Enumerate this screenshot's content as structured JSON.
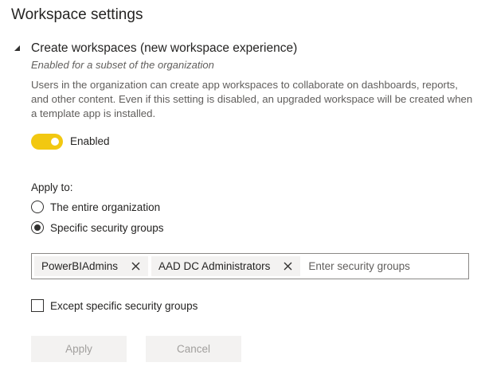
{
  "page": {
    "title": "Workspace settings"
  },
  "section": {
    "title": "Create workspaces (new workspace experience)",
    "subtitle": "Enabled for a subset of the organization",
    "description": "Users in the organization can create app workspaces to collaborate on dashboards, reports, and other content. Even if this setting is disabled, an upgraded workspace will be created when a template app is installed.",
    "collapse_icon": "triangle-down-icon"
  },
  "toggle": {
    "label": "Enabled",
    "on": true,
    "color": "#f2c811"
  },
  "apply_to": {
    "label": "Apply to:",
    "options": [
      {
        "label": "The entire organization",
        "checked": false
      },
      {
        "label": "Specific security groups",
        "checked": true
      }
    ]
  },
  "security_groups": {
    "tags": [
      {
        "label": "PowerBIAdmins"
      },
      {
        "label": "AAD DC Administrators"
      }
    ],
    "placeholder": "Enter security groups",
    "remove_icon": "close-icon"
  },
  "except": {
    "label": "Except specific security groups",
    "checked": false
  },
  "buttons": {
    "apply_label": "Apply",
    "cancel_label": "Cancel"
  }
}
